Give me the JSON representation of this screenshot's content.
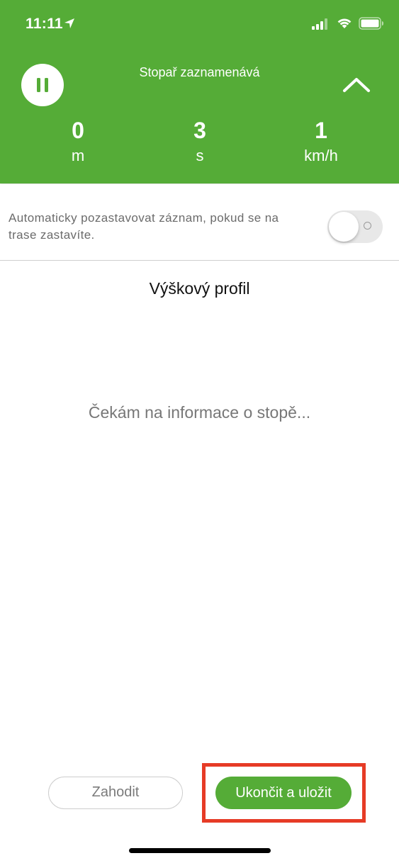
{
  "status_bar": {
    "time": "11:11",
    "icons": [
      "location-arrow-icon",
      "cellular-signal-icon",
      "wifi-icon",
      "battery-icon"
    ]
  },
  "header": {
    "title": "Stopař zaznamenává",
    "pause_icon": "pause-icon",
    "collapse_icon": "chevron-up-icon",
    "stats": {
      "distance": {
        "value": "0",
        "unit": "m"
      },
      "time": {
        "value": "3",
        "unit": "s"
      },
      "speed": {
        "value": "1",
        "unit": "km/h"
      }
    }
  },
  "auto_pause": {
    "label": "Automaticky pozastavovat záznam, pokud se na trase zastavíte.",
    "enabled": false
  },
  "elevation": {
    "title": "Výškový profil",
    "waiting_text": "Čekám na informace o stopě..."
  },
  "actions": {
    "discard_label": "Zahodit",
    "save_label": "Ukončit a uložit"
  },
  "colors": {
    "brand_green": "#55ac37",
    "highlight_red": "#e63b26"
  }
}
